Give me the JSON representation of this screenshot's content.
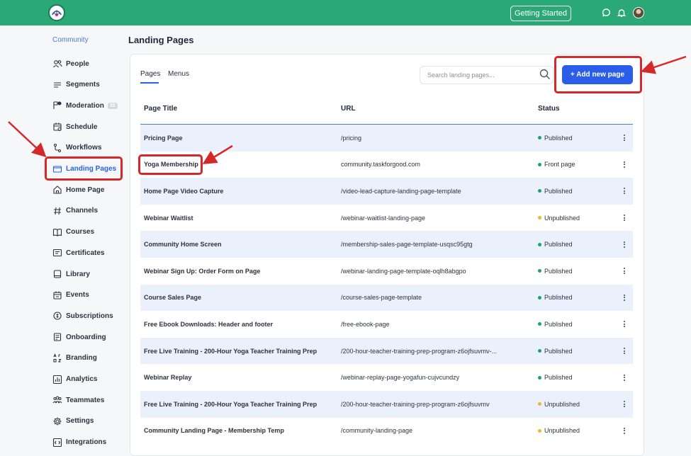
{
  "topbar": {
    "getting_started_label": "Getting Started",
    "brand_color": "#2aa876"
  },
  "sidebar": {
    "section_label": "Community",
    "items": [
      {
        "label": "People",
        "icon": "people-icon"
      },
      {
        "label": "Segments",
        "icon": "segments-icon"
      },
      {
        "label": "Moderation",
        "icon": "moderation-icon",
        "badge": "32"
      },
      {
        "label": "Schedule",
        "icon": "schedule-icon"
      },
      {
        "label": "Workflows",
        "icon": "workflows-icon"
      },
      {
        "label": "Landing Pages",
        "icon": "landing-pages-icon",
        "active": true
      },
      {
        "label": "Home Page",
        "icon": "home-icon"
      },
      {
        "label": "Channels",
        "icon": "hash-icon"
      },
      {
        "label": "Courses",
        "icon": "book-icon"
      },
      {
        "label": "Certificates",
        "icon": "certificate-icon"
      },
      {
        "label": "Library",
        "icon": "library-icon"
      },
      {
        "label": "Events",
        "icon": "calendar-icon"
      },
      {
        "label": "Subscriptions",
        "icon": "subscriptions-icon"
      },
      {
        "label": "Onboarding",
        "icon": "onboarding-icon"
      },
      {
        "label": "Branding",
        "icon": "branding-icon"
      },
      {
        "label": "Analytics",
        "icon": "analytics-icon"
      },
      {
        "label": "Teammates",
        "icon": "teammates-icon"
      },
      {
        "label": "Settings",
        "icon": "gear-icon"
      },
      {
        "label": "Integrations",
        "icon": "integrations-icon"
      }
    ]
  },
  "main": {
    "title": "Landing Pages",
    "tabs": [
      {
        "label": "Pages",
        "active": true
      },
      {
        "label": "Menus",
        "active": false
      }
    ],
    "search": {
      "placeholder": "Search landing pages..."
    },
    "add_button_label": "+ Add new page",
    "table": {
      "columns": [
        "Page Title",
        "URL",
        "Status"
      ],
      "rows": [
        {
          "title": "Pricing Page",
          "url": "/pricing",
          "status": "Published"
        },
        {
          "title": "Yoga Membership",
          "url": "community.taskforgood.com",
          "status": "Front page"
        },
        {
          "title": "Home Page Video Capture",
          "url": "/video-lead-capture-landing-page-template",
          "status": "Published"
        },
        {
          "title": "Webinar Waitlist",
          "url": "/webinar-waitlist-landing-page",
          "status": "Unpublished"
        },
        {
          "title": "Community Home Screen",
          "url": "/membership-sales-page-template-usqsc95gtg",
          "status": "Published"
        },
        {
          "title": "Webinar Sign Up: Order Form on Page",
          "url": "/webinar-landing-page-template-oqlh8abgpo",
          "status": "Published"
        },
        {
          "title": "Course Sales Page",
          "url": "/course-sales-page-template",
          "status": "Published"
        },
        {
          "title": "Free Ebook Downloads: Header and footer",
          "url": "/free-ebook-page",
          "status": "Published"
        },
        {
          "title": "Free Live Training - 200-Hour Yoga Teacher Training Prep",
          "url": "/200-hour-teacher-training-prep-program-z6ojfsuvmv-...",
          "status": "Published"
        },
        {
          "title": "Webinar Replay",
          "url": "/webinar-replay-page-yogafun-cujvcundzy",
          "status": "Published"
        },
        {
          "title": "Free Live Training - 200-Hour Yoga Teacher Training Prep",
          "url": "/200-hour-teacher-training-prep-program-z6ojfsuvmv",
          "status": "Unpublished"
        },
        {
          "title": "Community Landing Page - Membership Temp",
          "url": "/community-landing-page",
          "status": "Unpublished"
        }
      ]
    },
    "status_colors": {
      "published": "#22a06b",
      "unpublished": "#e8b931"
    }
  }
}
